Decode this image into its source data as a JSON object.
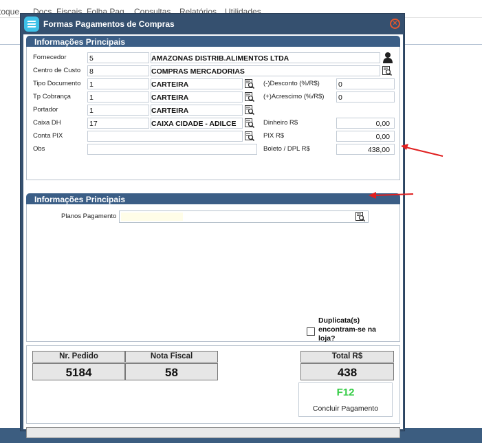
{
  "background_menu": [
    "toque",
    "Docs. Fiscais",
    "Folha Pag.",
    "Consultas",
    "Relatórios",
    "Utilidades"
  ],
  "dialog": {
    "title": "Formas Pagamentos de Compras",
    "close_glyph": "×"
  },
  "section1": {
    "title": "Informações Principais",
    "fornecedor": {
      "label": "Fornecedor",
      "code": "5",
      "name": "AMAZONAS DISTRIB.ALIMENTOS LTDA"
    },
    "centro_custo": {
      "label": "Centro de Custo",
      "code": "8",
      "name": "COMPRAS MERCADORIAS"
    },
    "tipo_documento": {
      "label": "Tipo Documento",
      "code": "1",
      "name": "CARTEIRA"
    },
    "tp_cobranca": {
      "label": "Tp Cobrança",
      "code": "1",
      "name": "CARTEIRA"
    },
    "portador": {
      "label": "Portador",
      "code": "1",
      "name": "CARTEIRA"
    },
    "caixa_dh": {
      "label": "Caixa DH",
      "code": "17",
      "name": "CAIXA CIDADE - ADILCE"
    },
    "conta_pix": {
      "label": "Conta PIX",
      "code": "",
      "name": ""
    },
    "obs": {
      "label": "Obs",
      "value": ""
    },
    "desconto": {
      "label": "(-)Desconto  (%/R$)",
      "value": "0"
    },
    "acrescimo": {
      "label": "(+)Acrescimo (%/R$)",
      "value": "0"
    },
    "dinheiro": {
      "label": "Dinheiro R$",
      "value": "0,00"
    },
    "pix": {
      "label": "PIX R$",
      "value": "0,00"
    },
    "boleto": {
      "label": "Boleto / DPL R$",
      "value": "438,00"
    }
  },
  "section2": {
    "title": "Informações Principais",
    "planos_label": "Planos Pagamento",
    "planos_value": "",
    "duplicata_label": "Duplicata(s) encontram-se na loja?",
    "duplicata_checked": false
  },
  "summary": {
    "nr_pedido_label": "Nr. Pedido",
    "nr_pedido": "5184",
    "nota_fiscal_label": "Nota Fiscal",
    "nota_fiscal": "58",
    "total_label": "Total R$",
    "total": "438",
    "concluir_key": "F12",
    "concluir_label": "Concluir Pagamento"
  },
  "colors": {
    "title_bar": "#35506f",
    "section_header": "#3b5e86",
    "arrow": "#e02020",
    "accent_green": "#33cc44"
  },
  "icons": [
    "app-logo-icon",
    "close-icon",
    "person-icon",
    "lookup-icon",
    "f12-key-icon",
    "arrow-annotation"
  ]
}
